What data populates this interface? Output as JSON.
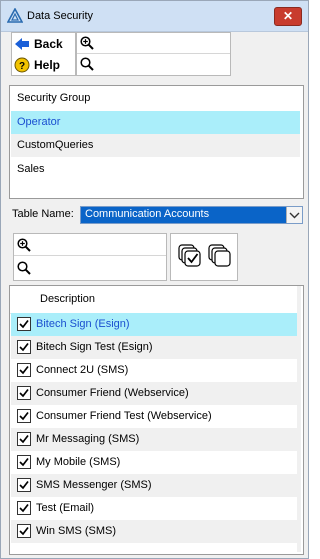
{
  "window": {
    "title": "Data Security"
  },
  "toolbar": {
    "back_label": "Back",
    "help_label": "Help"
  },
  "groups": [
    {
      "label": "Security Group",
      "selected": false
    },
    {
      "label": "Operator",
      "selected": true
    },
    {
      "label": "CustomQueries",
      "selected": false
    },
    {
      "label": "Sales",
      "selected": false
    }
  ],
  "table_name": {
    "label": "Table Name:",
    "value": "Communication Accounts"
  },
  "description_header": "Description",
  "items": [
    {
      "label": "Bitech Sign (Esign)",
      "checked": true,
      "selected": true
    },
    {
      "label": "Bitech Sign Test (Esign)",
      "checked": true,
      "selected": false
    },
    {
      "label": "Connect 2U (SMS)",
      "checked": true,
      "selected": false
    },
    {
      "label": "Consumer Friend (Webservice)",
      "checked": true,
      "selected": false
    },
    {
      "label": "Consumer Friend Test (Webservice)",
      "checked": true,
      "selected": false
    },
    {
      "label": "Mr Messaging (SMS)",
      "checked": true,
      "selected": false
    },
    {
      "label": "My Mobile (SMS)",
      "checked": true,
      "selected": false
    },
    {
      "label": "SMS Messenger (SMS)",
      "checked": true,
      "selected": false
    },
    {
      "label": "Test (Email)",
      "checked": true,
      "selected": false
    },
    {
      "label": "Win SMS (SMS)",
      "checked": true,
      "selected": false
    }
  ],
  "colors": {
    "selection": "#aaeefa",
    "combo": "#0a64c8",
    "back_arrow": "#1a5fd8",
    "help_icon": "#f2c300"
  }
}
